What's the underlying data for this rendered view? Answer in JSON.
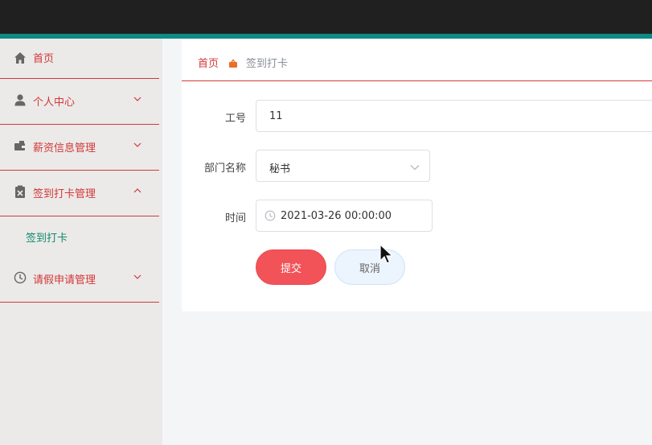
{
  "sidebar": {
    "items": [
      {
        "label": "首页",
        "icon": "home-icon"
      },
      {
        "label": "个人中心",
        "icon": "user-icon"
      },
      {
        "label": "薪资信息管理",
        "icon": "wallet-icon"
      },
      {
        "label": "签到打卡管理",
        "icon": "clipboard-icon",
        "expanded": true
      },
      {
        "label": "签到打卡",
        "sub": true
      },
      {
        "label": "请假申请管理",
        "icon": "clock-icon"
      }
    ]
  },
  "breadcrumb": {
    "home": "首页",
    "current": "签到打卡"
  },
  "form": {
    "employee_id": {
      "label": "工号",
      "value": "11"
    },
    "department": {
      "label": "部门名称",
      "value": "秘书"
    },
    "time": {
      "label": "时间",
      "value": "2021-03-26 00:00:00"
    }
  },
  "buttons": {
    "submit": "提交",
    "cancel": "取消"
  },
  "colors": {
    "accent_red": "#d33737",
    "teal": "#0e8b85",
    "submit_bg": "#f25358",
    "cancel_bg": "#ecf4fd",
    "topbar": "#202020",
    "submenu_green": "#11896a"
  }
}
